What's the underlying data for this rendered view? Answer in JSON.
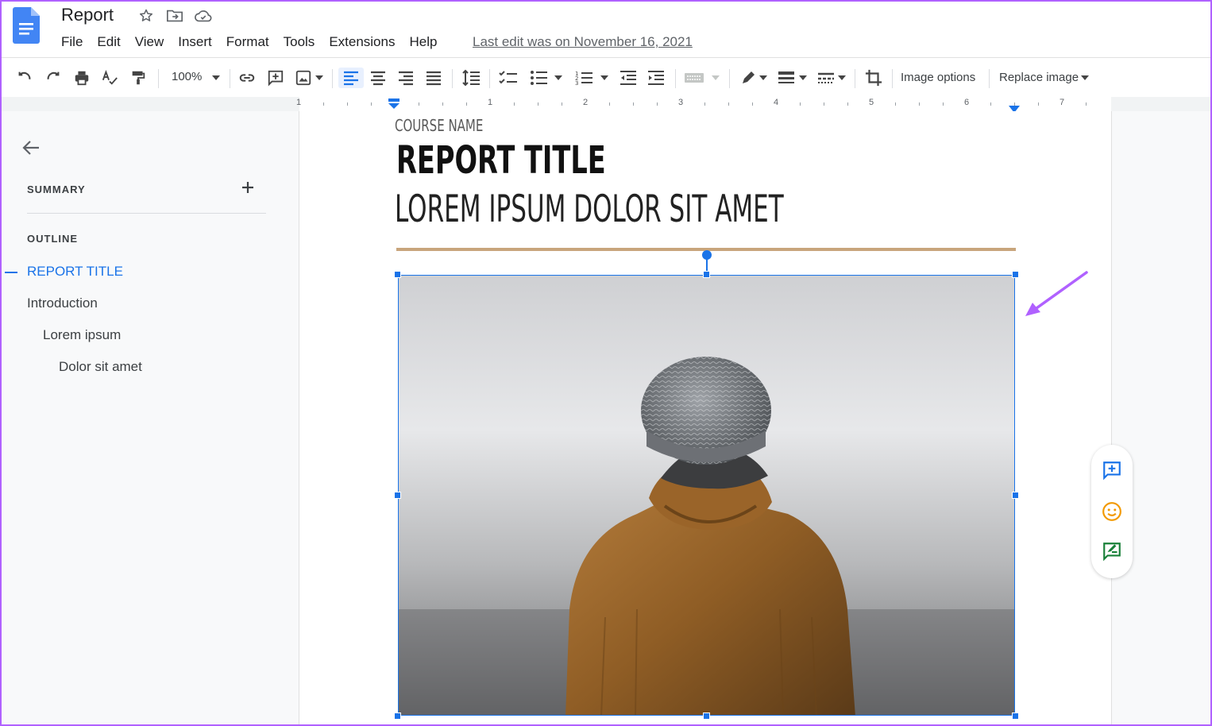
{
  "app": {
    "doc_title": "Report",
    "last_edit": "Last edit was on November 16, 2021"
  },
  "menu": [
    "File",
    "Edit",
    "View",
    "Insert",
    "Format",
    "Tools",
    "Extensions",
    "Help"
  ],
  "toolbar": {
    "zoom": "100%",
    "image_options": "Image options",
    "replace_image": "Replace image"
  },
  "ruler": [
    "1",
    "1",
    "2",
    "3",
    "4",
    "5",
    "6",
    "7"
  ],
  "sidebar": {
    "summary": "SUMMARY",
    "outline": "OUTLINE",
    "items": [
      {
        "label": "REPORT TITLE",
        "active": true
      },
      {
        "label": "Introduction"
      },
      {
        "label": "Lorem ipsum"
      },
      {
        "label": "Dolor sit amet"
      }
    ]
  },
  "document": {
    "course_name": "COURSE NAME",
    "report_title": "REPORT TITLE",
    "subtitle": "LOREM IPSUM DOLOR SIT AMET"
  },
  "colors": {
    "accent": "#1a73e8",
    "rule": "#c8a57c",
    "annotation_arrow": "#b061ff"
  }
}
